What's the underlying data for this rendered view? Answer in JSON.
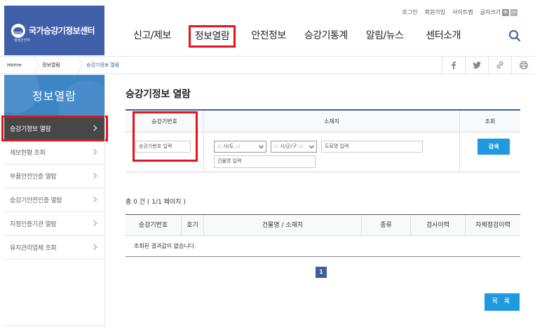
{
  "header": {
    "logo_text": "국가승강기정보센터",
    "logo_sub": "행정안전부",
    "util": {
      "login": "로그인",
      "join": "회원가입",
      "sitemap": "사이트맵",
      "font_size": "글자크기",
      "font_plus": "+",
      "font_minus": "−"
    },
    "gnb": [
      "신고/제보",
      "정보열람",
      "안전정보",
      "승강기통계",
      "알림/뉴스",
      "센터소개"
    ]
  },
  "breadcrumb": {
    "home": "Home",
    "level1": "정보열람",
    "level2": "승강기정보 열람"
  },
  "sidebar": {
    "title": "정보열람",
    "items": [
      {
        "label": "승강기정보 열람"
      },
      {
        "label": "제보현황 조회"
      },
      {
        "label": "부품안전인증 열람"
      },
      {
        "label": "승강기안전인증 열람"
      },
      {
        "label": "지정인증기관 열람"
      },
      {
        "label": "유지관리업체 조회"
      }
    ]
  },
  "main": {
    "title": "승강기정보 열람",
    "search": {
      "col_number": "승강기번호",
      "col_location": "소재지",
      "col_search": "조회",
      "number_placeholder": "승강기번호 입력",
      "sido_selected": "::: 시/도 :::",
      "sigungu_selected": "::: 시/군/구 :::",
      "road_placeholder": "도로명 입력",
      "building_placeholder": "건물명 입력",
      "search_button": "검색"
    },
    "total": "총 0 건 ( 1/1 페이지 )",
    "results": {
      "columns": [
        "승강기번호",
        "호기",
        "건물명 / 소재지",
        "종류",
        "검사이력",
        "자체점검이력"
      ],
      "empty_message": "조회된 결과값이 없습니다."
    },
    "pager": {
      "current": "1"
    },
    "list_button": "목 록"
  },
  "colors": {
    "brand_blue": "#3f5fa8",
    "side_blue": "#3d86c6",
    "button_blue": "#1f9ae0",
    "highlight_red": "#e0161e"
  }
}
